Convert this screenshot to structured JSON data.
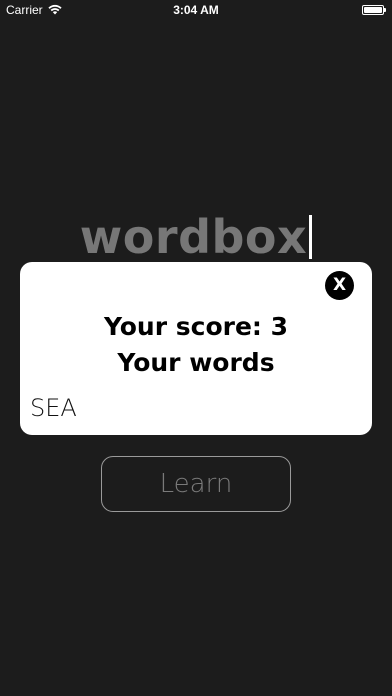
{
  "status_bar": {
    "carrier": "Carrier",
    "time": "3:04 AM",
    "wifi_icon": "wifi-icon",
    "battery_icon": "battery-icon"
  },
  "app": {
    "logo": "wordbox"
  },
  "modal": {
    "close_label": "X",
    "score_label": "Your score:",
    "score_value": "3",
    "words_heading": "Your words",
    "words": [
      "SEA"
    ]
  },
  "main": {
    "learn_label": "Learn"
  },
  "colors": {
    "background": "#1c1c1c",
    "logo": "#777777",
    "modal_bg": "#ffffff",
    "close_bg": "#000000"
  }
}
